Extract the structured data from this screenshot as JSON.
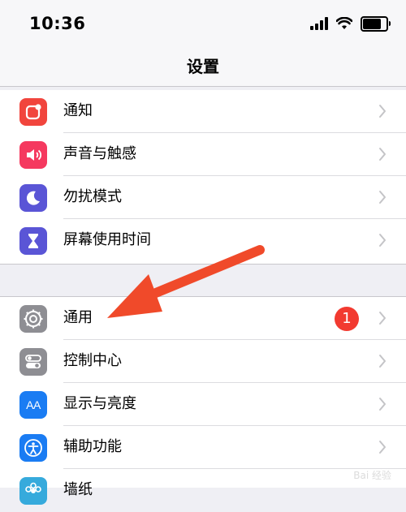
{
  "status_bar": {
    "time": "10:36"
  },
  "nav": {
    "title": "设置"
  },
  "groups": [
    {
      "items": [
        {
          "label": "通知",
          "icon": "notifications-icon",
          "color": "#f1453d"
        },
        {
          "label": "声音与触感",
          "icon": "speaker-icon",
          "color": "#f5395f"
        },
        {
          "label": "勿扰模式",
          "icon": "moon-icon",
          "color": "#5a55d6"
        },
        {
          "label": "屏幕使用时间",
          "icon": "hourglass-icon",
          "color": "#5a55d6"
        }
      ]
    },
    {
      "items": [
        {
          "label": "通用",
          "icon": "gear-icon",
          "color": "#8e8e93",
          "badge": "1"
        },
        {
          "label": "控制中心",
          "icon": "toggles-icon",
          "color": "#8e8e93"
        },
        {
          "label": "显示与亮度",
          "icon": "aa-text-icon",
          "color": "#1a7cf3",
          "icon_text": "AA"
        },
        {
          "label": "辅助功能",
          "icon": "accessibility-icon",
          "color": "#1a7cf3"
        },
        {
          "label": "墙纸",
          "icon": "wallpaper-icon",
          "color": "#36aadc"
        }
      ]
    }
  ],
  "annotation": {
    "arrow_color": "#f04a2a"
  },
  "watermark": {
    "text": "Bai 经验"
  }
}
